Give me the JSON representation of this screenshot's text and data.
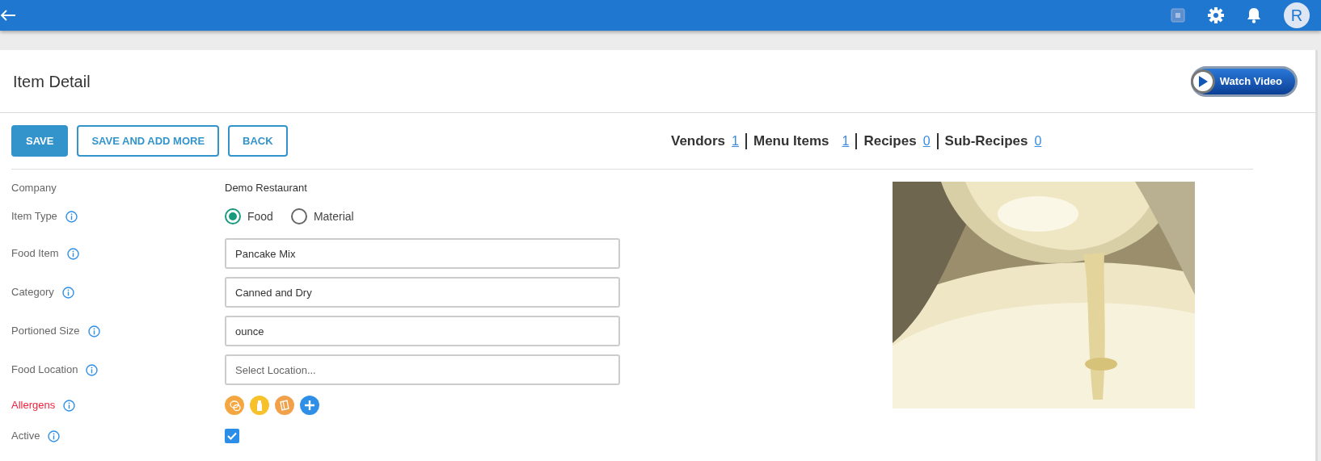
{
  "header": {
    "avatar_letter": "R"
  },
  "page": {
    "title": "Item Detail",
    "video_button": "Watch Video"
  },
  "buttons": [
    {
      "label": "SAVE",
      "kind": "primary"
    },
    {
      "label": "SAVE AND ADD MORE",
      "kind": "outline"
    },
    {
      "label": "BACK",
      "kind": "outline"
    }
  ],
  "counts": [
    {
      "label": "Vendors",
      "value": "1"
    },
    {
      "label": "Menu Items",
      "value": "1"
    },
    {
      "label": "Recipes",
      "value": "0"
    },
    {
      "label": "Sub-Recipes",
      "value": "0"
    }
  ],
  "fields": [
    {
      "label": "Company",
      "kind": "text",
      "value": "Demo Restaurant",
      "info": false
    },
    {
      "label": "Item Type",
      "kind": "radio",
      "info": true,
      "options": [
        {
          "label": "Food",
          "selected": true
        },
        {
          "label": "Material",
          "selected": false
        }
      ]
    },
    {
      "label": "Food Item",
      "kind": "input",
      "info": true,
      "value": "Pancake Mix"
    },
    {
      "label": "Category",
      "kind": "input",
      "info": true,
      "value": "Canned and Dry"
    },
    {
      "label": "Portioned Size",
      "kind": "input",
      "info": true,
      "value": "ounce"
    },
    {
      "label": "Food Location",
      "kind": "input",
      "info": true,
      "placeholder": "Select Location..."
    },
    {
      "label": "Allergens",
      "kind": "allergens",
      "info": true,
      "required": true,
      "allergens": [
        {
          "kind": "egg",
          "color": "#f4a640"
        },
        {
          "kind": "milk",
          "color": "#f7c12b"
        },
        {
          "kind": "wheat",
          "color": "#f0a14a"
        }
      ]
    },
    {
      "label": "Active",
      "kind": "checkbox",
      "info": true,
      "checked": true
    }
  ]
}
